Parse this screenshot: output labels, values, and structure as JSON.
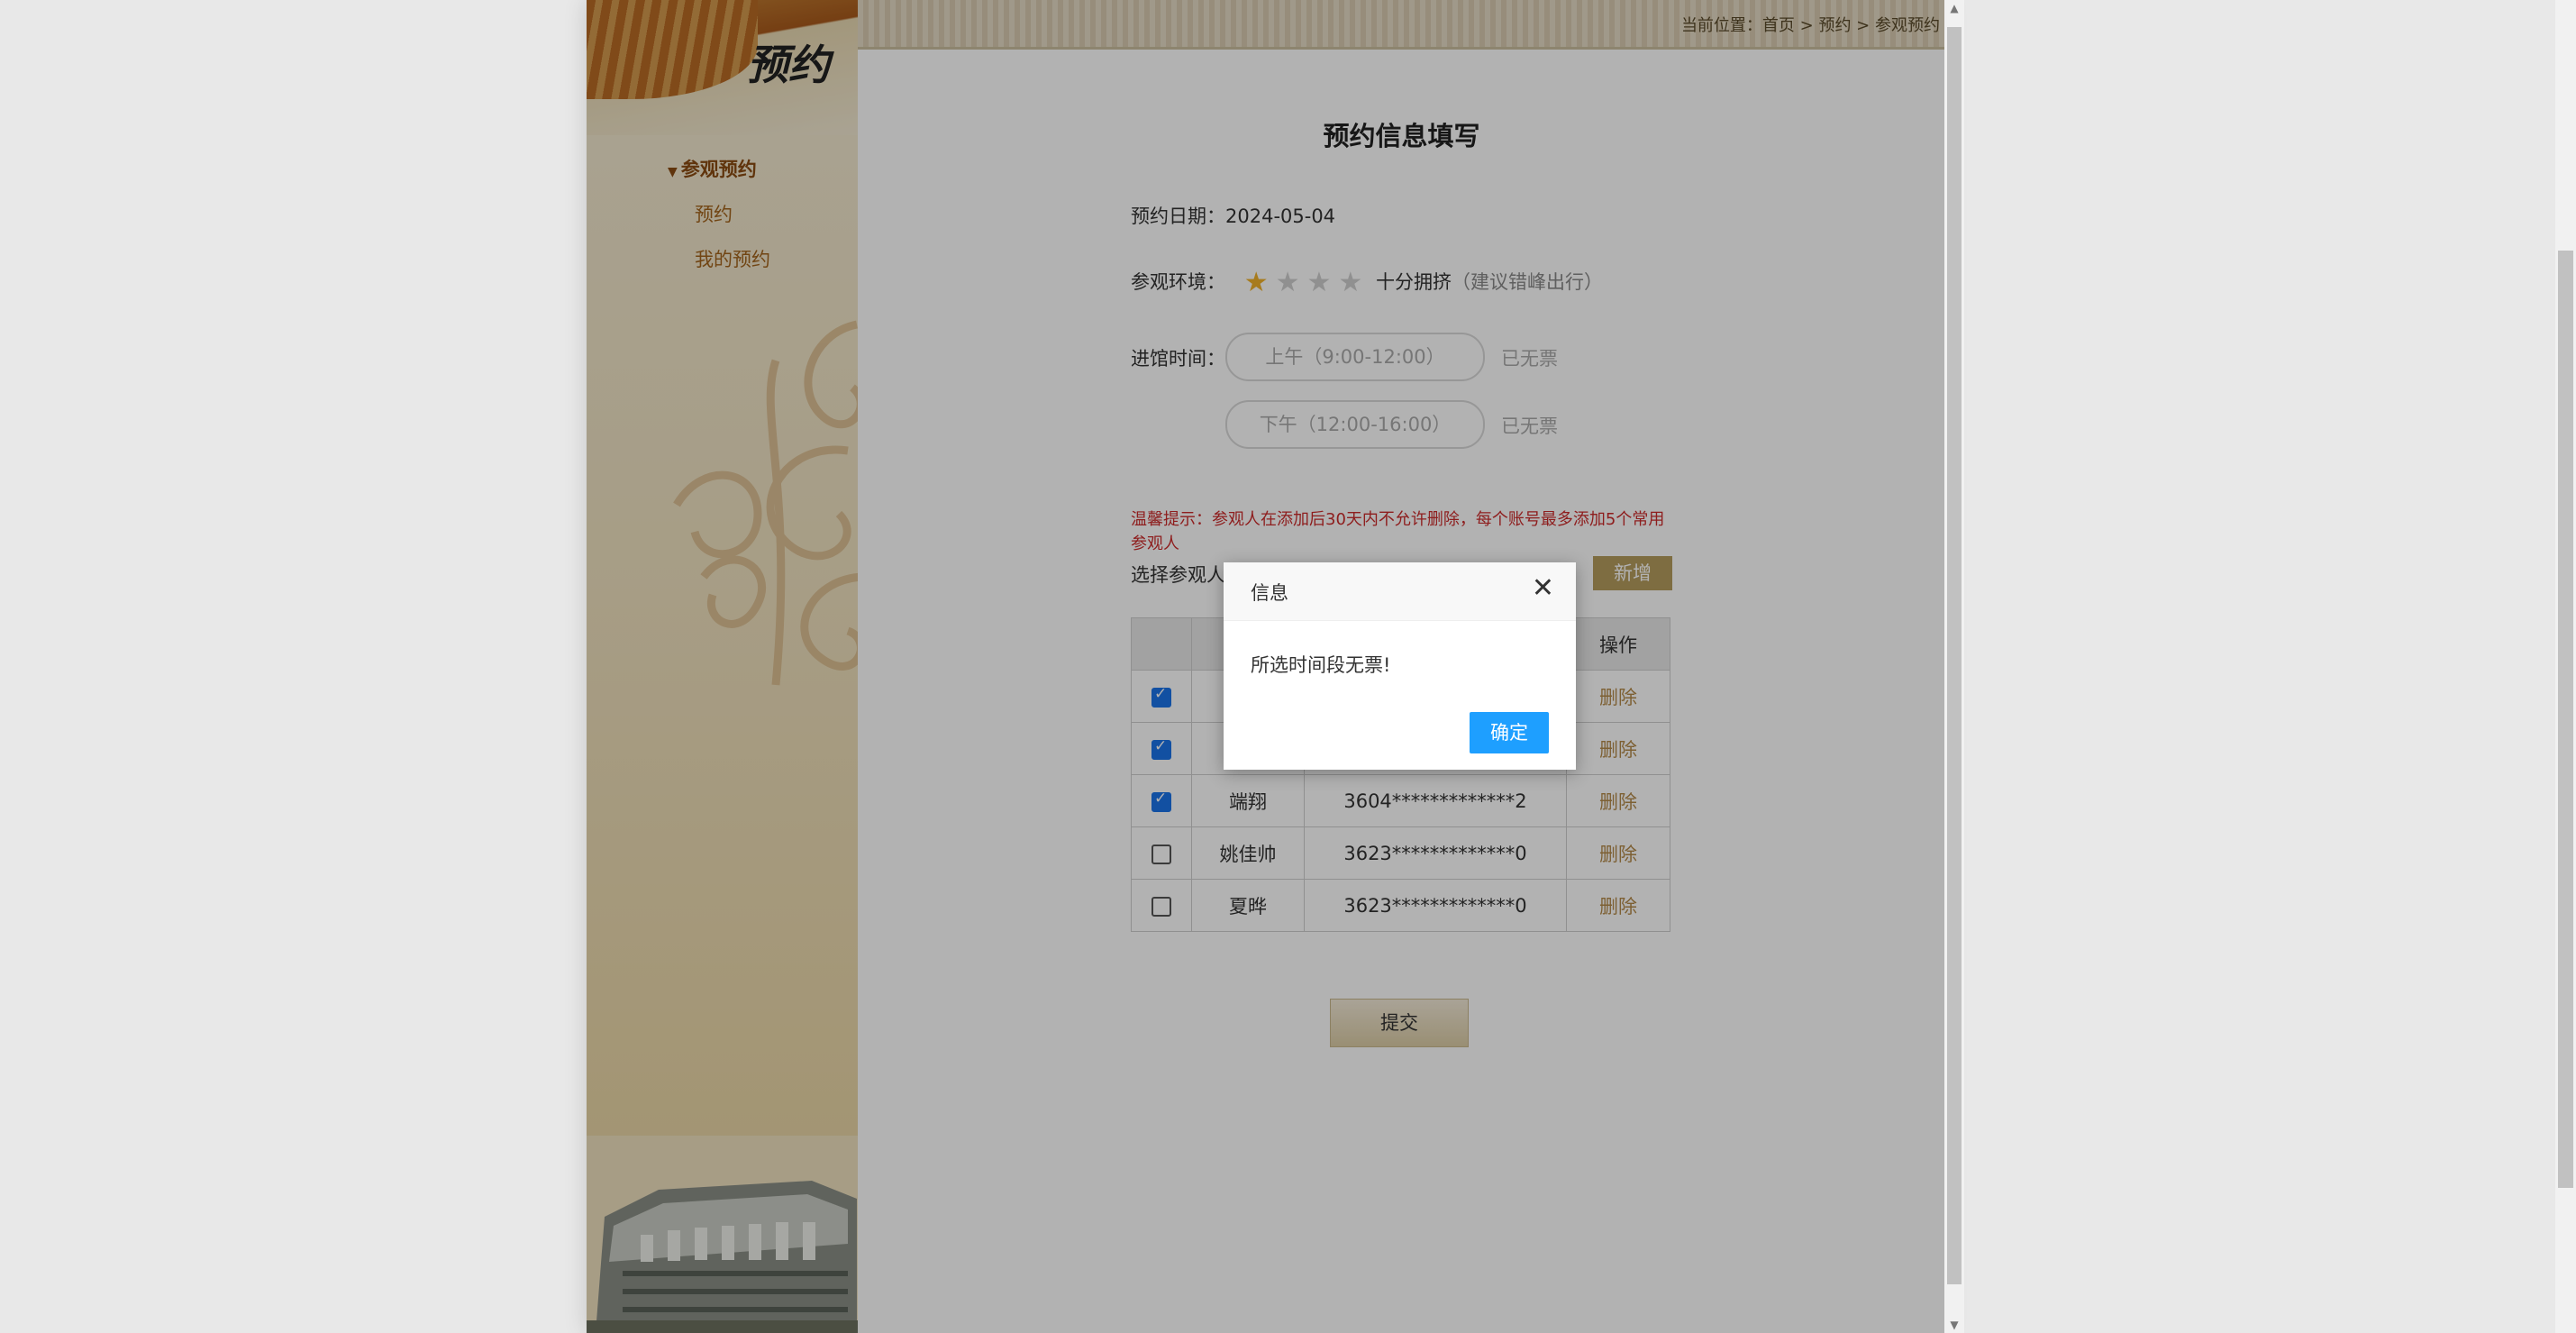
{
  "sidebar": {
    "banner_title": "预约",
    "group_label": "参观预约",
    "items": [
      {
        "label": "预约"
      },
      {
        "label": "我的预约"
      }
    ]
  },
  "breadcrumb": "当前位置：首页 > 预约 > 参观预约",
  "form": {
    "title": "预约信息填写",
    "date_label": "预约日期：",
    "date_value": "2024-05-04",
    "env_label": "参观环境：",
    "env_rating": 1,
    "env_max": 4,
    "env_text": "十分拥挤",
    "env_hint": "（建议错峰出行）",
    "time_label": "进馆时间：",
    "slots": [
      {
        "label": "上午（9:00-12:00）",
        "status": "已无票"
      },
      {
        "label": "下午（12:00-16:00）",
        "status": "已无票"
      }
    ],
    "warning": "温馨提示：参观人在添加后30天内不允许删除，每个账号最多添加5个常用参观人",
    "visitor_label": "选择参观人",
    "add_label": "新增",
    "table": {
      "headers": [
        "",
        "",
        "",
        "操作"
      ],
      "rows": [
        {
          "checked": true,
          "name": "",
          "id": "",
          "action": "删除"
        },
        {
          "checked": true,
          "name": "",
          "id": "",
          "action": "删除"
        },
        {
          "checked": true,
          "name": "端翔",
          "id": "3604*************2",
          "action": "删除"
        },
        {
          "checked": false,
          "name": "姚佳帅",
          "id": "3623*************0",
          "action": "删除"
        },
        {
          "checked": false,
          "name": "夏晔",
          "id": "3623*************0",
          "action": "删除"
        }
      ]
    },
    "submit_label": "提交"
  },
  "dialog": {
    "title": "信息",
    "message": "所选时间段无票!",
    "ok_label": "确定"
  },
  "colors": {
    "accent": "#1e9fff",
    "warning": "#cc2b2b",
    "link": "#b48a4a",
    "star_on": "#f0b12a"
  }
}
